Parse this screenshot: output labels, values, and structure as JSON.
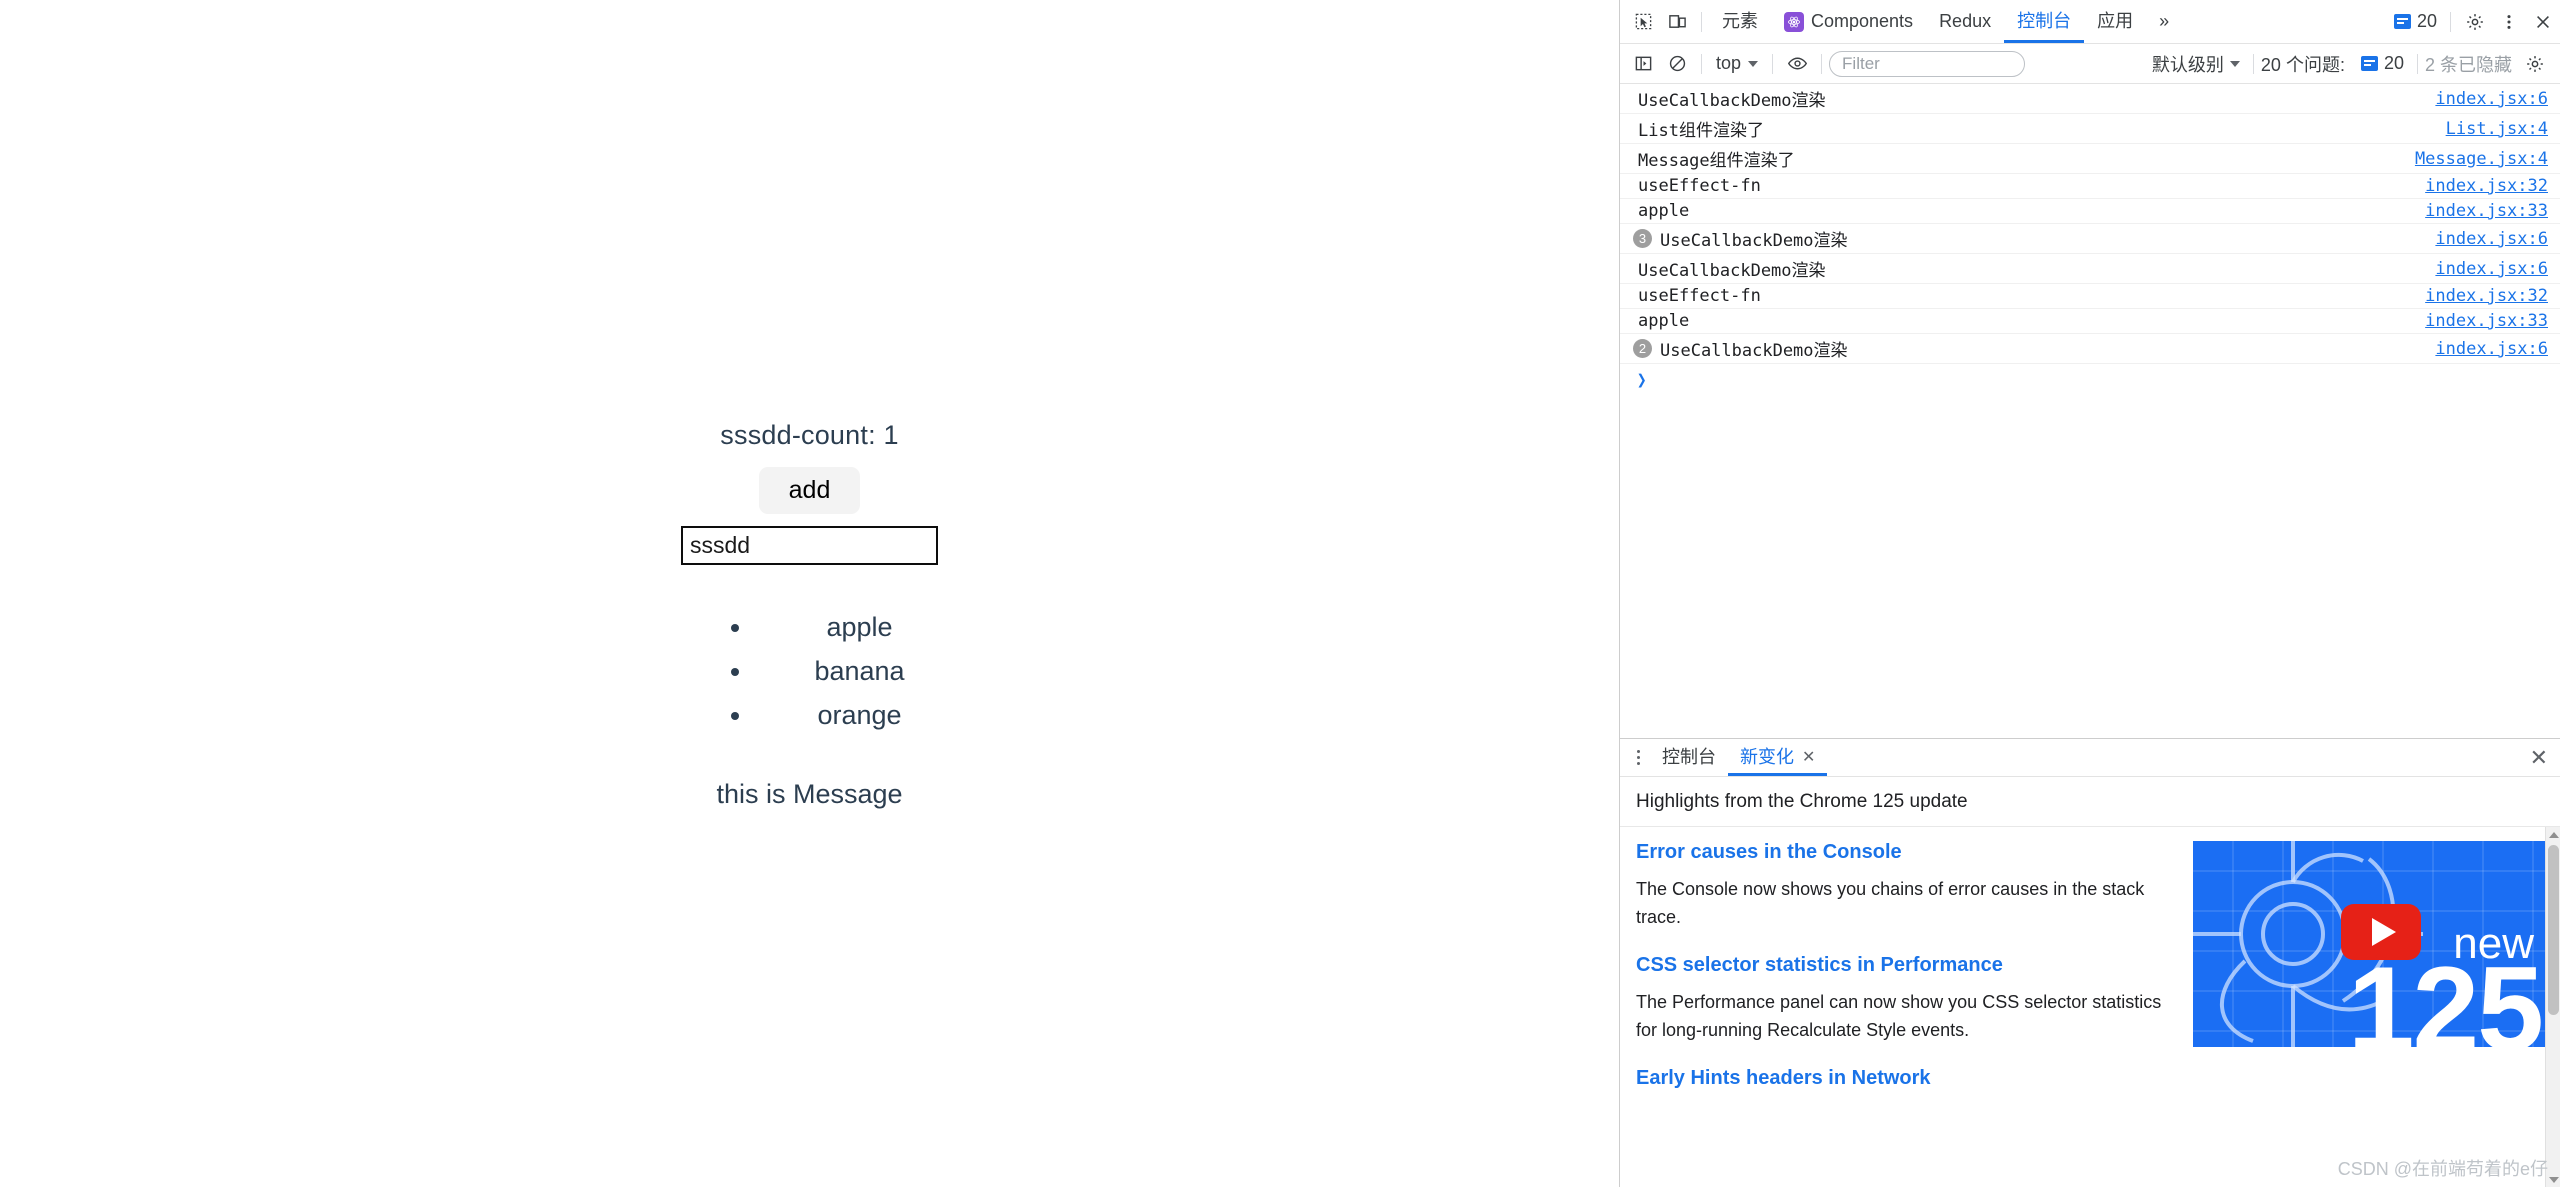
{
  "page": {
    "count_label": "sssdd-count: 1",
    "add_button": "add",
    "input_value": "sssdd",
    "input_placeholder": "",
    "list_items": [
      "apple",
      "banana",
      "orange"
    ],
    "message": "this is Message",
    "text_color": "#2c3e50"
  },
  "devtools": {
    "tabs": [
      {
        "label": "元素",
        "active": false
      },
      {
        "label": "Components",
        "active": false,
        "icon": "react-logo-icon"
      },
      {
        "label": "Redux",
        "active": false
      },
      {
        "label": "控制台",
        "active": true
      },
      {
        "label": "应用",
        "active": false
      },
      {
        "label": "»",
        "active": false
      }
    ],
    "icons": {
      "inspect": "inspect-element-icon",
      "device": "device-toolbar-icon",
      "more_tabs": "more-tabs-icon",
      "settings": "gear-icon",
      "more": "kebab-menu-icon",
      "close": "close-icon"
    },
    "issues_count": "20",
    "accent_color": "#1a73e8",
    "filterbar": {
      "sidebar_toggle": "console-sidebar-icon",
      "clear_console": "clear-console-icon",
      "context": "top",
      "eye": "live-expression-icon",
      "filter_placeholder": "Filter",
      "filter_value": "",
      "level": "默认级别",
      "issues_text": "20 个问题:",
      "issues_badge": "20",
      "hidden_text": "2 条已隐藏",
      "settings": "gear-icon"
    },
    "console_rows": [
      {
        "badge": "",
        "message": "UseCallbackDemo渲染",
        "source": "index.jsx:6"
      },
      {
        "badge": "",
        "message": "List组件渲染了",
        "source": "List.jsx:4"
      },
      {
        "badge": "",
        "message": "Message组件渲染了",
        "source": "Message.jsx:4"
      },
      {
        "badge": "",
        "message": "useEffect-fn",
        "source": "index.jsx:32"
      },
      {
        "badge": "",
        "message": "apple",
        "source": "index.jsx:33"
      },
      {
        "badge": "3",
        "message": "UseCallbackDemo渲染",
        "source": "index.jsx:6"
      },
      {
        "badge": "",
        "message": "UseCallbackDemo渲染",
        "source": "index.jsx:6"
      },
      {
        "badge": "",
        "message": "useEffect-fn",
        "source": "index.jsx:32"
      },
      {
        "badge": "",
        "message": "apple",
        "source": "index.jsx:33"
      },
      {
        "badge": "2",
        "message": "UseCallbackDemo渲染",
        "source": "index.jsx:6"
      }
    ],
    "prompt": "❯",
    "drawer": {
      "tabs": [
        {
          "label": "控制台",
          "active": false,
          "closable": false
        },
        {
          "label": "新变化",
          "active": true,
          "closable": true
        }
      ],
      "close_label": "✕",
      "headline": "Highlights from the Chrome 125 update",
      "sections": [
        {
          "heading": "Error causes in the Console",
          "body": "The Console now shows you chains of error causes in the stack trace."
        },
        {
          "heading": "CSS selector statistics in Performance",
          "body": "The Performance panel can now show you CSS selector statistics for long-running Recalculate Style events."
        },
        {
          "heading": "Early Hints headers in Network",
          "body": ""
        }
      ],
      "thumbnail": {
        "new_text": "new",
        "version_text": "125",
        "play": "youtube-play-icon",
        "bg_color": "#1b6ef3"
      }
    }
  },
  "watermark": "CSDN @在前端苟着的e仔"
}
